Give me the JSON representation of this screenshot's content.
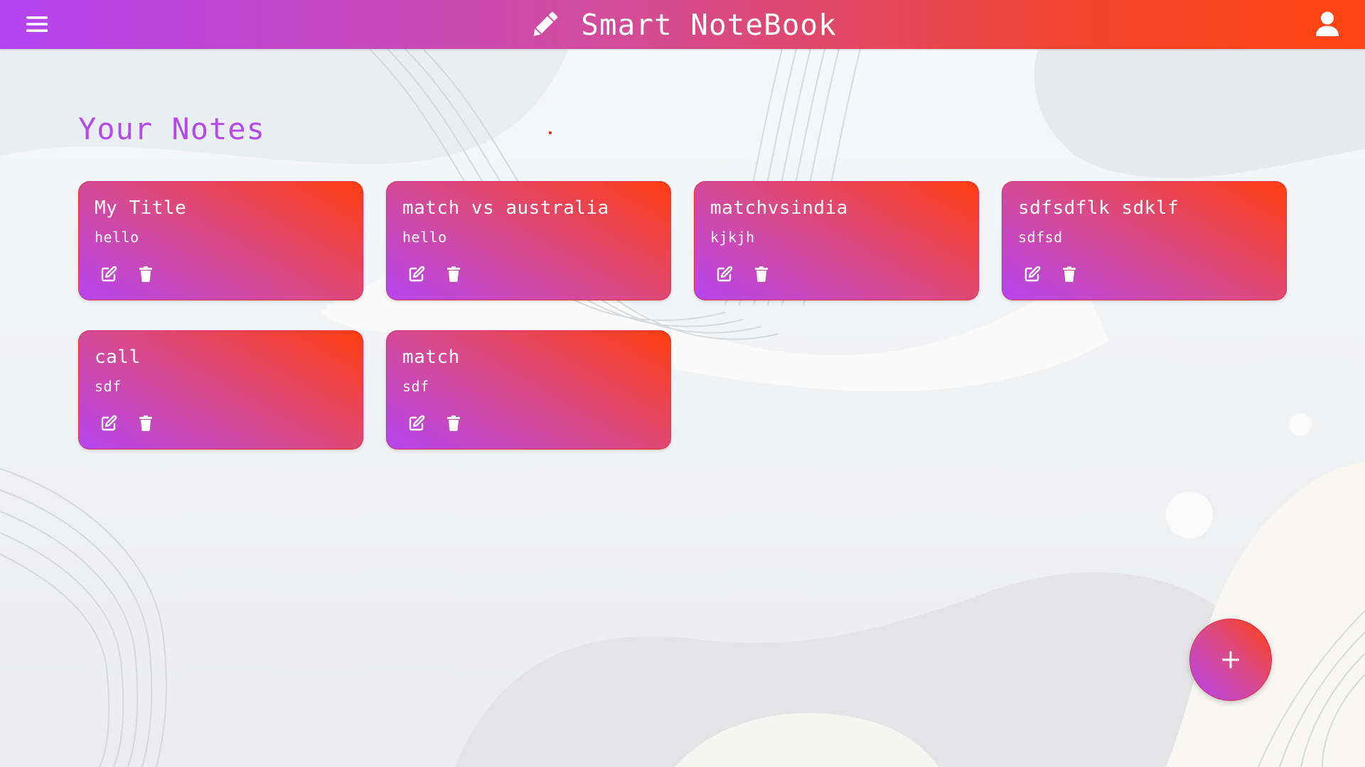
{
  "header": {
    "app_title": "Smart NoteBook",
    "brand_icon": "pencil-icon",
    "menu_icon": "hamburger-menu-icon",
    "user_icon": "user-icon",
    "gradient": [
      "#b444f2",
      "#fe4412"
    ]
  },
  "main": {
    "title": "Your Notes",
    "title_color": "#b64ae8"
  },
  "notes": [
    {
      "title": "My Title",
      "body": "hello"
    },
    {
      "title": "match vs australia",
      "body": "hello"
    },
    {
      "title": "matchvsindia",
      "body": "kjkjh"
    },
    {
      "title": "sdfsdflk sdklf",
      "body": "sdfsd"
    },
    {
      "title": "call",
      "body": "sdf"
    },
    {
      "title": "match",
      "body": "sdf"
    }
  ],
  "note_actions": {
    "edit_icon": "edit-icon",
    "delete_icon": "trash-icon"
  },
  "fab": {
    "label": "+",
    "icon": "plus-icon"
  },
  "colors": {
    "accent_purple": "#b645f0",
    "accent_orange": "#ff3d10"
  }
}
